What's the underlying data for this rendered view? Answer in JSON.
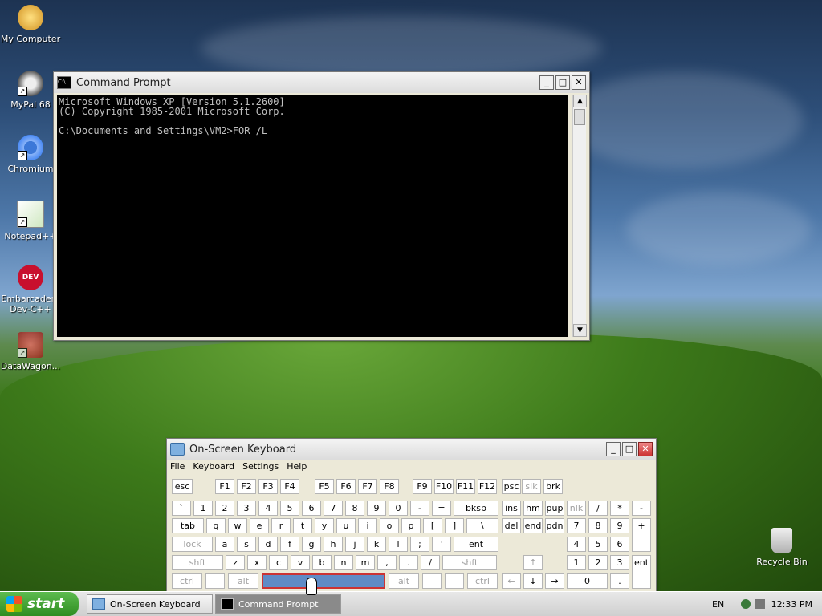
{
  "desktop": {
    "icons": [
      {
        "label": "My Computer"
      },
      {
        "label": "MyPal 68"
      },
      {
        "label": "Chromium"
      },
      {
        "label": "Notepad++"
      },
      {
        "label": "Embarcadero\nDev-C++"
      },
      {
        "label": "DataWagon..."
      },
      {
        "label": "Recycle Bin"
      }
    ]
  },
  "cmd": {
    "title": "Command Prompt",
    "lines": [
      "Microsoft Windows XP [Version 5.1.2600]",
      "(C) Copyright 1985-2001 Microsoft Corp.",
      "",
      "C:\\Documents and Settings\\VM2>FOR /L"
    ]
  },
  "osk": {
    "title": "On-Screen Keyboard",
    "menu": [
      "File",
      "Keyboard",
      "Settings",
      "Help"
    ],
    "rows": {
      "fn": [
        "esc",
        "F1",
        "F2",
        "F3",
        "F4",
        "F5",
        "F6",
        "F7",
        "F8",
        "F9",
        "F10",
        "F11",
        "F12",
        "psc",
        "slk",
        "brk"
      ],
      "num": [
        "`",
        "1",
        "2",
        "3",
        "4",
        "5",
        "6",
        "7",
        "8",
        "9",
        "0",
        "-",
        "=",
        "bksp",
        "ins",
        "hm",
        "pup",
        "nlk",
        "/",
        "*",
        "-"
      ],
      "tab": [
        "tab",
        "q",
        "w",
        "e",
        "r",
        "t",
        "y",
        "u",
        "i",
        "o",
        "p",
        "[",
        "]",
        "\\",
        "del",
        "end",
        "pdn",
        "7",
        "8",
        "9"
      ],
      "caps": [
        "lock",
        "a",
        "s",
        "d",
        "f",
        "g",
        "h",
        "j",
        "k",
        "l",
        ";",
        "'",
        "ent",
        "4",
        "5",
        "6"
      ],
      "shift": [
        "shft",
        "z",
        "x",
        "c",
        "v",
        "b",
        "n",
        "m",
        ",",
        ".",
        "/",
        "shft",
        "↑",
        "1",
        "2",
        "3"
      ],
      "bottom": [
        "ctrl",
        "alt",
        "alt",
        "ctrl",
        "←",
        "↓",
        "→",
        "0",
        "."
      ],
      "plus": "+",
      "ent2": "ent"
    }
  },
  "taskbar": {
    "start_label": "start",
    "buttons": [
      {
        "label": "On-Screen Keyboard"
      },
      {
        "label": "Command Prompt"
      }
    ],
    "lang": "EN",
    "clock": "12:33 PM"
  }
}
